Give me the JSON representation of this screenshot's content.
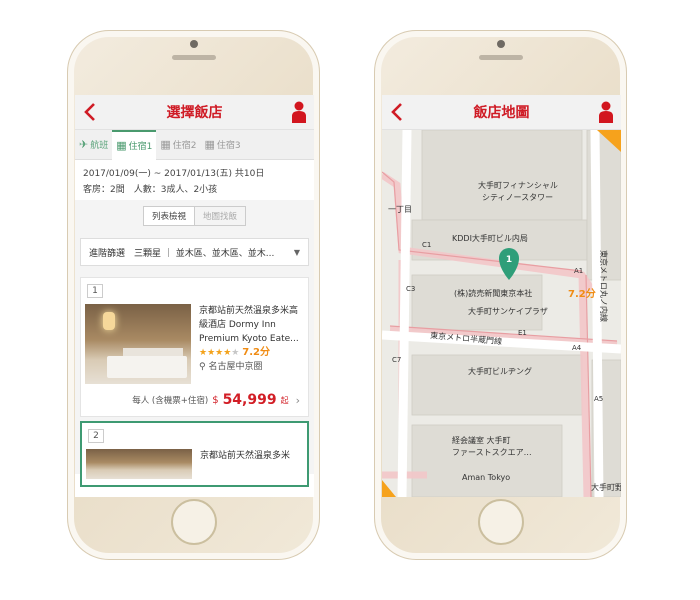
{
  "left_screen": {
    "title": "選擇飯店",
    "steps": [
      {
        "label": "航班",
        "state": "done"
      },
      {
        "label": "住宿1",
        "state": "active"
      },
      {
        "label": "住宿2",
        "state": "inactive"
      },
      {
        "label": "住宿3",
        "state": "inactive"
      }
    ],
    "date_range": "2017/01/09(一) ~ 2017/01/13(五) 共10日",
    "guests": "客房：2間　人數：3成人、2小孩",
    "view_toggle": {
      "list": "列表檢視",
      "map": "地圖找飯"
    },
    "filter_text": "進階篩選　三顆星 ｜ 並木區、並木區、並木...",
    "hotels": [
      {
        "index": "1",
        "name": "京都站前天然溫泉多米高級酒店 Dormy Inn Premium Kyoto Eate...",
        "stars": 4,
        "score": "7.2分",
        "location": "名古屋中京圈",
        "price_label": "每人 (含機票+住宿)",
        "currency": "$",
        "price": "54,999",
        "price_unit": "起"
      },
      {
        "index": "2",
        "name": "京都站前天然溫泉多米"
      }
    ]
  },
  "right_screen": {
    "title": "飯店地圖",
    "marker_number": "1",
    "marker_score": "7.2分",
    "map_labels": {
      "otemachi_financial": "大手町フィナンシャル",
      "city_north_tower": "シティノースタワー",
      "itchome": "一丁目",
      "kddi": "KDDI大手町ビル内局",
      "yomiuri": "(株)読売新聞東京本社",
      "sankei": "大手町サンケイプラザ",
      "hanzomon_line": "東京メトロ半蔵門線",
      "marunouchi_line": "東京メトロ丸ノ内線",
      "otemachi_building": "大手町ビルヂング",
      "keidanren1": "経会議室 大手町",
      "keidanren2": "ファーストスクエア…",
      "aman": "Aman Tokyo",
      "otemachi_no": "大手町野",
      "c1": "C1",
      "c3": "C3",
      "c7": "C7",
      "a1": "A1",
      "a4": "A4",
      "a5": "A5",
      "e1": "E1"
    }
  }
}
